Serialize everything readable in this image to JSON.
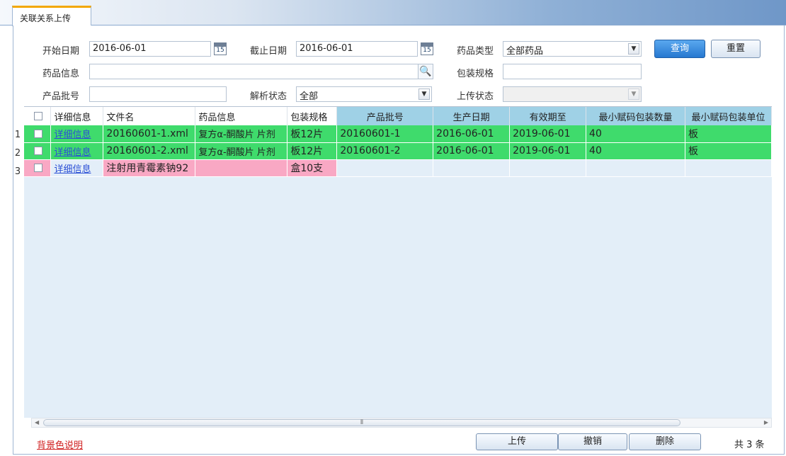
{
  "tab": {
    "label": "关联关系上传"
  },
  "filters": {
    "start_date_label": "开始日期",
    "start_date_value": "2016-06-01",
    "end_date_label": "截止日期",
    "end_date_value": "2016-06-01",
    "calendar_day": "15",
    "drug_type_label": "药品类型",
    "drug_type_value": "全部药品",
    "drug_info_label": "药品信息",
    "drug_info_value": "",
    "package_spec_label": "包装规格",
    "package_spec_value": "",
    "batch_label": "产品批号",
    "batch_value": "",
    "parse_status_label": "解析状态",
    "parse_status_value": "全部",
    "upload_status_label": "上传状态",
    "upload_status_value": ""
  },
  "buttons": {
    "query": "查询",
    "reset": "重置",
    "upload": "上传",
    "revoke": "撤销",
    "delete": "删除"
  },
  "table": {
    "columns": [
      "详细信息",
      "文件名",
      "药品信息",
      "包装规格",
      "产品批号",
      "生产日期",
      "有效期至",
      "最小赋码包装数量",
      "最小赋码包装单位"
    ],
    "rows": [
      {
        "num": "1",
        "detail": "详细信息",
        "file": "20160601-1.xml",
        "drug": "复方α-酮酸片 片剂",
        "spec": "板12片",
        "batch": "20160601-1",
        "prod_date": "2016-06-01",
        "expiry": "2019-06-01",
        "min_qty": "40",
        "min_unit": "板"
      },
      {
        "num": "2",
        "detail": "详细信息",
        "file": "20160601-2.xml",
        "drug": "复方α-酮酸片 片剂",
        "spec": "板12片",
        "batch": "20160601-2",
        "prod_date": "2016-06-01",
        "expiry": "2019-06-01",
        "min_qty": "40",
        "min_unit": "板"
      },
      {
        "num": "3",
        "detail": "详细信息",
        "file": "注射用青霉素钠92",
        "drug": "",
        "spec": "盒10支",
        "batch": "",
        "prod_date": "",
        "expiry": "",
        "min_qty": "",
        "min_unit": ""
      }
    ]
  },
  "footer": {
    "legend_link": "背景色说明",
    "total": "共 3 条"
  },
  "colors": {
    "row_green": "#3fdb6c",
    "row_pink": "#f9a8c4",
    "header_highlight": "#9fd1e6",
    "primary_button": "#2678d0"
  }
}
